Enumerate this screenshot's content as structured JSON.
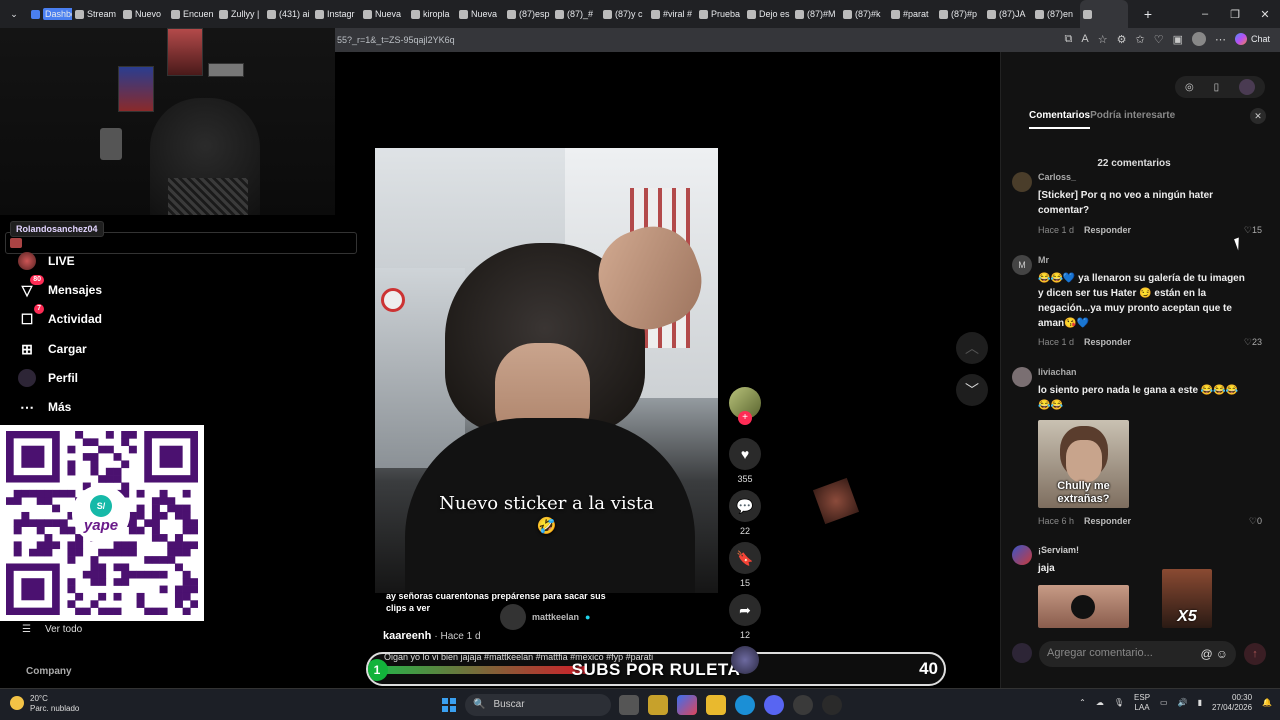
{
  "browser": {
    "tabs": [
      "Dashbo",
      "Stream",
      "Nuevo",
      "Encuen",
      "Zullyy |",
      "(431) ai",
      "Instagr",
      "Nueva",
      "kiropla",
      "Nueva",
      "(87)esp",
      "(87)_#",
      "(87)y c",
      "#viral #",
      "Prueba",
      "Dejo es",
      "(87)#M",
      "(87)#k",
      "#parat",
      "(87)#p",
      "(87)JA",
      "(87)en",
      ""
    ],
    "url": "55?_r=1&_t=ZS-95qajl2YK6q",
    "chat_label": "Chat",
    "new_tab": "+",
    "minimize": "–",
    "maximize": "❐",
    "close": "✕"
  },
  "sidebar": {
    "username_chip": "Rolandosanchez04",
    "items": [
      {
        "label": "LIVE",
        "icon": "live-icon",
        "badge": ""
      },
      {
        "label": "Mensajes",
        "icon": "messages-icon",
        "badge": "80"
      },
      {
        "label": "Actividad",
        "icon": "activity-icon",
        "badge": "7"
      },
      {
        "label": "Cargar",
        "icon": "upload-icon",
        "badge": ""
      },
      {
        "label": "Perfil",
        "icon": "profile-icon",
        "badge": ""
      },
      {
        "label": "Más",
        "icon": "more-icon",
        "badge": ""
      }
    ],
    "see_all": "Ver todo",
    "company": "Company",
    "qr_brand": "yape",
    "qr_currency": "S/"
  },
  "video": {
    "overlay_text": "Nuevo sticker a la vista",
    "caption": "ay señoras cuarentonas prepárense para sacar sus clips a ver",
    "music_user": "mattkeelan",
    "author": "kaareenh",
    "time": "· Hace 1 d",
    "hashtags": "Oigan yo lo vi bien jajaja #mattkeelan #mattfia #mexico #fyp #parati",
    "actions": {
      "likes": "355",
      "comments": "22",
      "saves": "15",
      "shares": "12"
    }
  },
  "stream_overlay": {
    "label": "SUBS POR RULETA",
    "count": "40",
    "index": "1",
    "progress": 0.38
  },
  "comments_panel": {
    "tab_comments": "Comentarios",
    "tab_interest": "Podría interesarte",
    "count_label": "22 comentarios",
    "comments": [
      {
        "user": "Carloss_",
        "text": "[Sticker] Por q no veo a ningún hater comentar?",
        "time": "Hace 1 d",
        "reply": "Responder",
        "likes": "15"
      },
      {
        "user": "Mr",
        "text": "😂😂💙 ya llenaron su galería de tu imagen y dicen ser tus Hater 😏 están en la negación...ya muy pronto aceptan que te aman😘💙",
        "time": "Hace 1 d",
        "reply": "Responder",
        "likes": "23"
      },
      {
        "user": "liviachan",
        "text": "lo siento pero nada le gana a este 😂😂😂😂😂",
        "time": "Hace 6 h",
        "reply": "Responder",
        "likes": "0",
        "sticker_text": "Chully me extrañas?"
      },
      {
        "user": "¡Serviam!",
        "text": "jaja",
        "time": "",
        "reply": "",
        "likes": "",
        "sticker_text": "X5"
      }
    ],
    "add_comment_placeholder": "Agregar comentario..."
  },
  "taskbar": {
    "temp": "20°C",
    "weather": "Parc. nublado",
    "search": "Buscar",
    "lang1": "ESP",
    "lang2": "LAA",
    "time": "00:30",
    "date": "27/04/2026"
  }
}
